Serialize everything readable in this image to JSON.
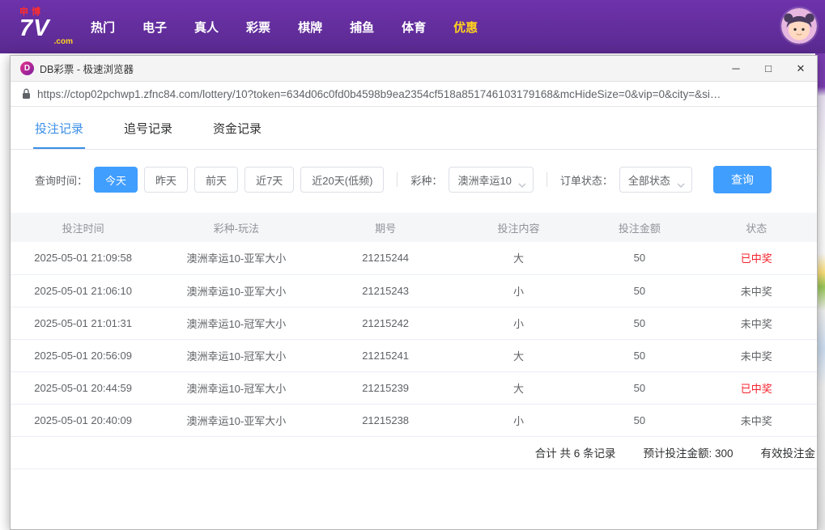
{
  "colors": {
    "topbar-start": "#6e32ab",
    "topbar-end": "#5a2a90",
    "accent": "#3a8ee6",
    "accent-btn": "#409eff",
    "highlight": "#ffd21e",
    "win-red": "#f5222d",
    "text-main": "#303133",
    "text-secondary": "#606266",
    "text-muted": "#909399",
    "border": "#ebeef5"
  },
  "topbar": {
    "logo": {
      "top": "申博",
      "main": "7V",
      "suffix": ".com"
    },
    "nav": [
      "热门",
      "电子",
      "真人",
      "彩票",
      "棋牌",
      "捕鱼",
      "体育",
      "优惠"
    ]
  },
  "browser": {
    "title": "DB彩票 - 极速浏览器",
    "app_icon_letter": "D",
    "minimize": "─",
    "maximize": "□",
    "close": "✕",
    "url": "https://ctop02pchwp1.zfnc84.com/lottery/10?token=634d06c0fd0b4598b9ea2354cf518a851746103179168&mcHideSize=0&vip=0&city=&si…"
  },
  "tabs": [
    {
      "label": "投注记录"
    },
    {
      "label": "追号记录"
    },
    {
      "label": "资金记录"
    }
  ],
  "filters": {
    "time_label": "查询时间：",
    "time_options": [
      "今天",
      "昨天",
      "前天",
      "近7天",
      "近20天(低频)"
    ],
    "active_time": "今天",
    "lottery_label": "彩种：",
    "lottery_value": "澳洲幸运10",
    "status_label": "订单状态：",
    "status_value": "全部状态",
    "query_button": "查询"
  },
  "table": {
    "headers": [
      "投注时间",
      "彩种-玩法",
      "期号",
      "投注内容",
      "投注金额",
      "状态"
    ],
    "rows": [
      {
        "time": "2025-05-01 21:09:58",
        "game": "澳洲幸运10-亚军大小",
        "issue": "21215244",
        "content": "大",
        "amount": "50",
        "status": "已中奖",
        "won": true
      },
      {
        "time": "2025-05-01 21:06:10",
        "game": "澳洲幸运10-亚军大小",
        "issue": "21215243",
        "content": "小",
        "amount": "50",
        "status": "未中奖",
        "won": false
      },
      {
        "time": "2025-05-01 21:01:31",
        "game": "澳洲幸运10-冠军大小",
        "issue": "21215242",
        "content": "小",
        "amount": "50",
        "status": "未中奖",
        "won": false
      },
      {
        "time": "2025-05-01 20:56:09",
        "game": "澳洲幸运10-冠军大小",
        "issue": "21215241",
        "content": "大",
        "amount": "50",
        "status": "未中奖",
        "won": false
      },
      {
        "time": "2025-05-01 20:44:59",
        "game": "澳洲幸运10-冠军大小",
        "issue": "21215239",
        "content": "大",
        "amount": "50",
        "status": "已中奖",
        "won": true
      },
      {
        "time": "2025-05-01 20:40:09",
        "game": "澳洲幸运10-亚军大小",
        "issue": "21215238",
        "content": "小",
        "amount": "50",
        "status": "未中奖",
        "won": false
      }
    ],
    "footer": {
      "summary": "合计 共 6 条记录",
      "expected": "预计投注金额: 300",
      "valid": "有效投注金"
    }
  }
}
